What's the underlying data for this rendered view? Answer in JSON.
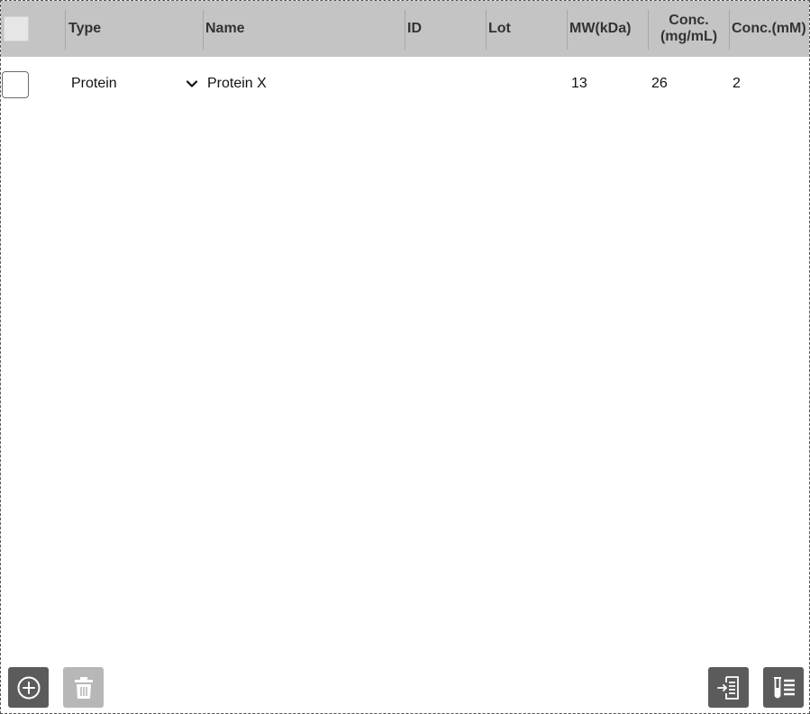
{
  "table": {
    "columns": [
      {
        "key": "type",
        "label": "Type"
      },
      {
        "key": "name",
        "label": "Name"
      },
      {
        "key": "id",
        "label": "ID"
      },
      {
        "key": "lot",
        "label": "Lot"
      },
      {
        "key": "mw",
        "label": "MW(kDa)"
      },
      {
        "key": "conc_mgml_line1",
        "label": "Conc."
      },
      {
        "key": "conc_mgml_line2",
        "label": "(mg/mL)"
      },
      {
        "key": "conc_mm",
        "label": "Conc.(mM)"
      }
    ],
    "rows": [
      {
        "type": "Protein",
        "name": "Protein X",
        "id": "",
        "lot": "",
        "mw": "13",
        "conc_mgml": "26",
        "conc_mm": "2"
      }
    ]
  },
  "toolbar": {
    "add_icon": "plus-circle-icon",
    "delete_icon": "trash-icon",
    "import_icon": "import-list-icon",
    "sample_list_icon": "test-tube-list-icon"
  }
}
